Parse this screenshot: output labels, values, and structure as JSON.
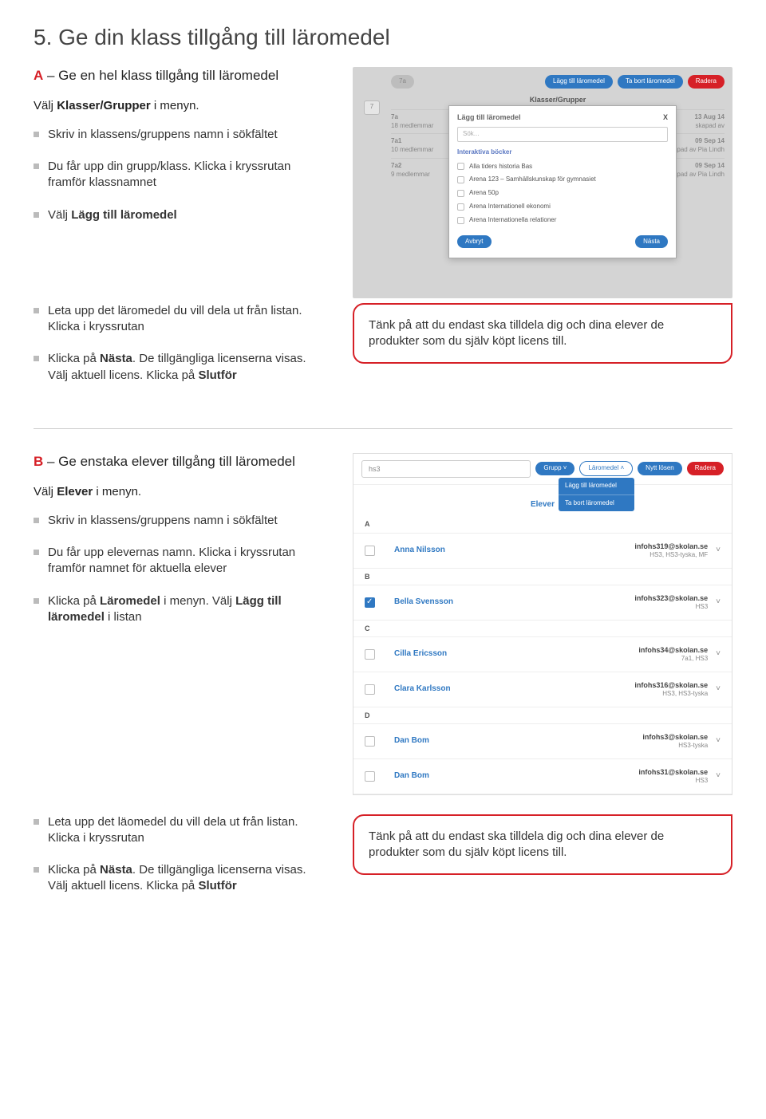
{
  "heading": "5. Ge din klass tillgång till läromedel",
  "sectionA": {
    "letter": "A",
    "title": " – Ge en hel klass tillgång till läromedel",
    "intro_pre": "Välj ",
    "intro_bold": "Klasser/Grupper",
    "intro_post": " i menyn.",
    "items": [
      {
        "text": "Skriv in klassens/gruppens namn i sökfältet"
      },
      {
        "text": "Du får upp din grupp/klass. Klicka i kryssrutan framför klassnamnet"
      },
      {
        "pre": "Välj ",
        "bold": "Lägg till läromedel"
      },
      {
        "text": "Leta upp det läromedel du vill dela ut från listan. Klicka i kryssrutan"
      },
      {
        "pre": "Klicka på ",
        "bold": "Nästa",
        "post": ". De tillgängliga licenserna visas. Välj aktuell licens. Klicka på ",
        "bold2": "Slutför"
      }
    ]
  },
  "callout": "Tänk på att du endast ska tilldela dig och dina elever de produkter som du själv köpt licens till.",
  "shot1": {
    "search_pill": "7a",
    "btn_add": "Lägg till läromedel",
    "btn_remove": "Ta bort läromedel",
    "btn_delete": "Radera",
    "sidetab": "7",
    "bg_header": "Klasser/Grupper",
    "modal_title": "Lägg till läromedel",
    "close": "X",
    "search_placeholder": "Sök...",
    "category": "Interaktiva böcker",
    "options": [
      "Alla tiders historia Bas",
      "Arena 123 – Samhällskunskap för gymnasiet",
      "Arena 50p",
      "Arena Internationell ekonomi",
      "Arena Internationella relationer"
    ],
    "btn_cancel": "Avbryt",
    "btn_next": "Nästa",
    "bg_rows": [
      {
        "name": "7a",
        "sub": "18 medlemmar",
        "date": "13 Aug 14",
        "by": "skapad av"
      },
      {
        "name": "7a1",
        "sub": "10 medlemmar",
        "date": "09 Sep 14",
        "by": "skapad av Pia Lindh"
      },
      {
        "name": "7a2",
        "sub": "9 medlemmar",
        "date": "09 Sep 14",
        "by": "skapad av Pia Lindh"
      }
    ]
  },
  "sectionB": {
    "letter": "B",
    "title": " – Ge enstaka elever tillgång till läromedel",
    "intro_pre": "Välj ",
    "intro_bold": "Elever",
    "intro_post": " i menyn.",
    "items": [
      {
        "text": "Skriv in klassens/gruppens namn i sökfältet"
      },
      {
        "text": "Du får upp elevernas namn. Klicka i kryssrutan framför namnet för aktuella elever"
      },
      {
        "pre": "Klicka på ",
        "bold": "Läromedel",
        "post": " i menyn. Välj ",
        "bold2": "Lägg till läromedel",
        "post2": " i listan"
      },
      {
        "text": "Leta upp det läomedel du vill dela ut från listan. Klicka i kryssrutan"
      },
      {
        "pre": "Klicka på ",
        "bold": "Nästa",
        "post": ". De tillgängliga licenserna visas. Välj aktuell licens. Klicka på ",
        "bold2": "Slutför"
      }
    ]
  },
  "shot2": {
    "search": "hs3",
    "btn_group": "Grupp ˅",
    "btn_laro": "Läromedel ˄",
    "btn_pwd": "Nytt lösen",
    "btn_del": "Radera",
    "dd1": "Lägg till läromedel",
    "dd2": "Ta bort läromedel",
    "header": "Elever",
    "rows": [
      {
        "letter": "A"
      },
      {
        "name": "Anna Nilsson",
        "email": "infohs319@skolan.se",
        "sub": "HS3, HS3-tyska, MF"
      },
      {
        "letter": "B"
      },
      {
        "name": "Bella Svensson",
        "email": "infohs323@skolan.se",
        "sub": "HS3",
        "checked": true
      },
      {
        "letter": "C"
      },
      {
        "name": "Cilla Ericsson",
        "email": "infohs34@skolan.se",
        "sub": "7a1, HS3"
      },
      {
        "name": "Clara Karlsson",
        "email": "infohs316@skolan.se",
        "sub": "HS3, HS3-tyska"
      },
      {
        "letter": "D"
      },
      {
        "name": "Dan Bom",
        "email": "infohs3@skolan.se",
        "sub": "HS3-tyska"
      },
      {
        "name": "Dan Bom",
        "email": "infohs31@skolan.se",
        "sub": "HS3"
      }
    ]
  }
}
